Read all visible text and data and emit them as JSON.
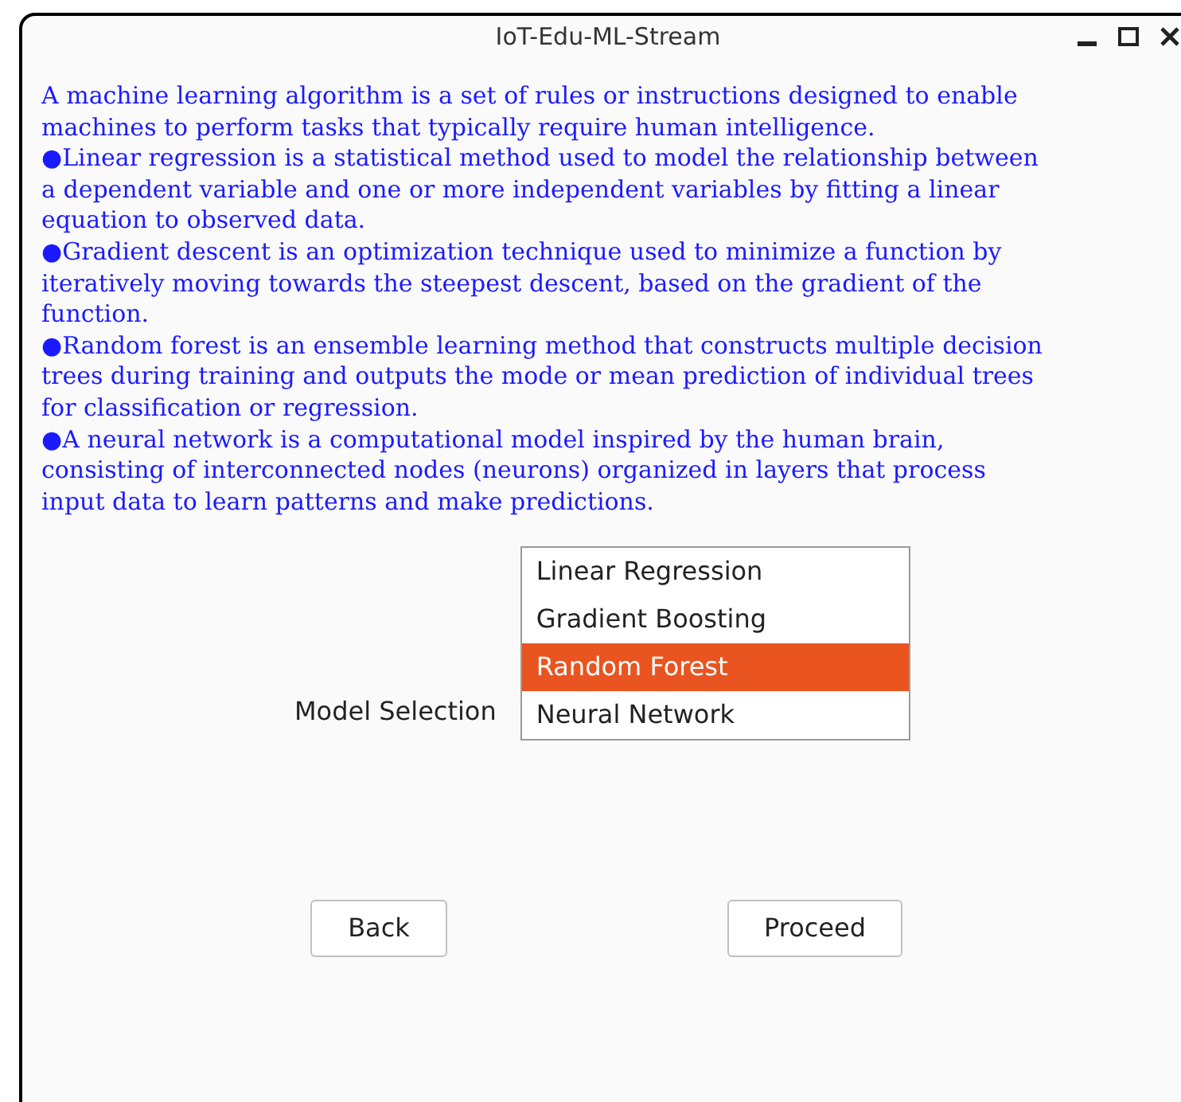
{
  "window": {
    "title": "IoT-Edu-ML-Stream"
  },
  "paragraphs": [
    {
      "lines": [
        "A machine learning algorithm is a set of rules or instructions designed to enable",
        "machines to perform tasks that typically require human intelligence."
      ]
    },
    {
      "lines": [
        "●Linear regression is a statistical method used to model the relationship between",
        "a dependent variable and one or more independent variables by fitting a linear",
        "equation to observed data."
      ]
    },
    {
      "lines": [
        "●Gradient descent is an optimization technique used to minimize a function by",
        "iteratively moving towards the steepest descent, based on the gradient of the",
        "function."
      ]
    },
    {
      "lines": [
        "●Random forest is an ensemble learning method that constructs multiple decision",
        "trees during training and outputs the mode or mean prediction of individual trees",
        "for classification or regression."
      ]
    },
    {
      "lines": [
        "●A neural network is a computational model inspired by the human brain,",
        "consisting of interconnected nodes (neurons) organized in layers that process",
        "input data to learn patterns and make predictions."
      ]
    }
  ],
  "model_selection": {
    "label": "Model Selection",
    "options": [
      {
        "label": "Linear Regression",
        "selected": false
      },
      {
        "label": "Gradient Boosting",
        "selected": false
      },
      {
        "label": "Random Forest",
        "selected": true
      },
      {
        "label": "Neural Network",
        "selected": false
      }
    ]
  },
  "buttons": [
    {
      "label": "Back"
    },
    {
      "label": "Proceed"
    }
  ]
}
